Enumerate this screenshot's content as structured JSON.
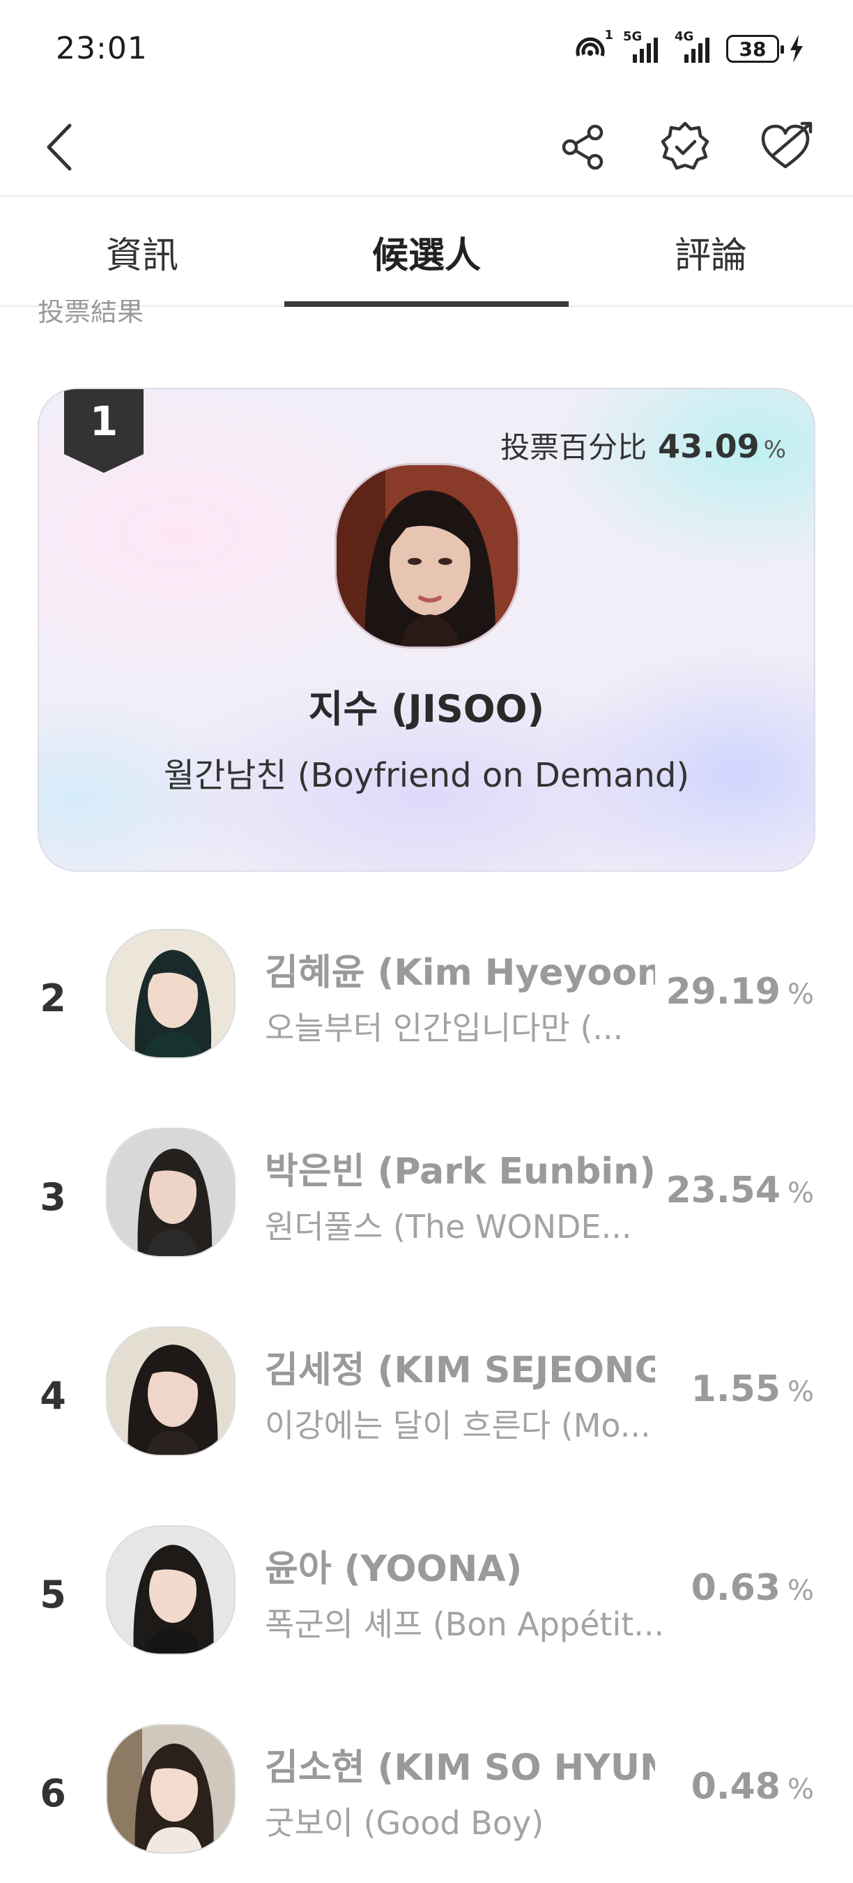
{
  "status_bar": {
    "time": "23:01",
    "hotspot_badge": "1",
    "net1": "5G",
    "net2": "4G",
    "battery": "38"
  },
  "header": {
    "back_icon": "chevron-left-icon",
    "share_icon": "share-icon",
    "verify_icon": "badge-check-icon",
    "favorite_icon": "heart-arrow-icon"
  },
  "tabs": [
    {
      "label": "資訊",
      "active": false
    },
    {
      "label": "候選人",
      "active": true
    },
    {
      "label": "評論",
      "active": false
    }
  ],
  "section_label": "投票結果",
  "top_candidate": {
    "rank": "1",
    "vote_label": "投票百分比",
    "percent": "43.09",
    "unit": "%",
    "name": "지수 (JISOO)",
    "show": "월간남친 (Boyfriend on Demand)"
  },
  "candidates": [
    {
      "rank": "2",
      "name": "김혜윤 (Kim Hyeyoon)",
      "show": "오늘부터 인간입니다만 (...",
      "percent": "29.19",
      "unit": "%"
    },
    {
      "rank": "3",
      "name": "박은빈 (Park Eunbin)",
      "show": "원더풀스 (The WONDE...",
      "percent": "23.54",
      "unit": "%"
    },
    {
      "rank": "4",
      "name": "김세정 (KIM SEJEONG)",
      "show": "이강에는 달이 흐른다 (Mo...",
      "percent": "1.55",
      "unit": "%"
    },
    {
      "rank": "5",
      "name": "윤아 (YOONA)",
      "show": "폭군의 셰프 (Bon Appétit...",
      "percent": "0.63",
      "unit": "%"
    },
    {
      "rank": "6",
      "name": "김소현 (KIM SO HYUN)",
      "show": "굿보이 (Good Boy)",
      "percent": "0.48",
      "unit": "%"
    }
  ]
}
